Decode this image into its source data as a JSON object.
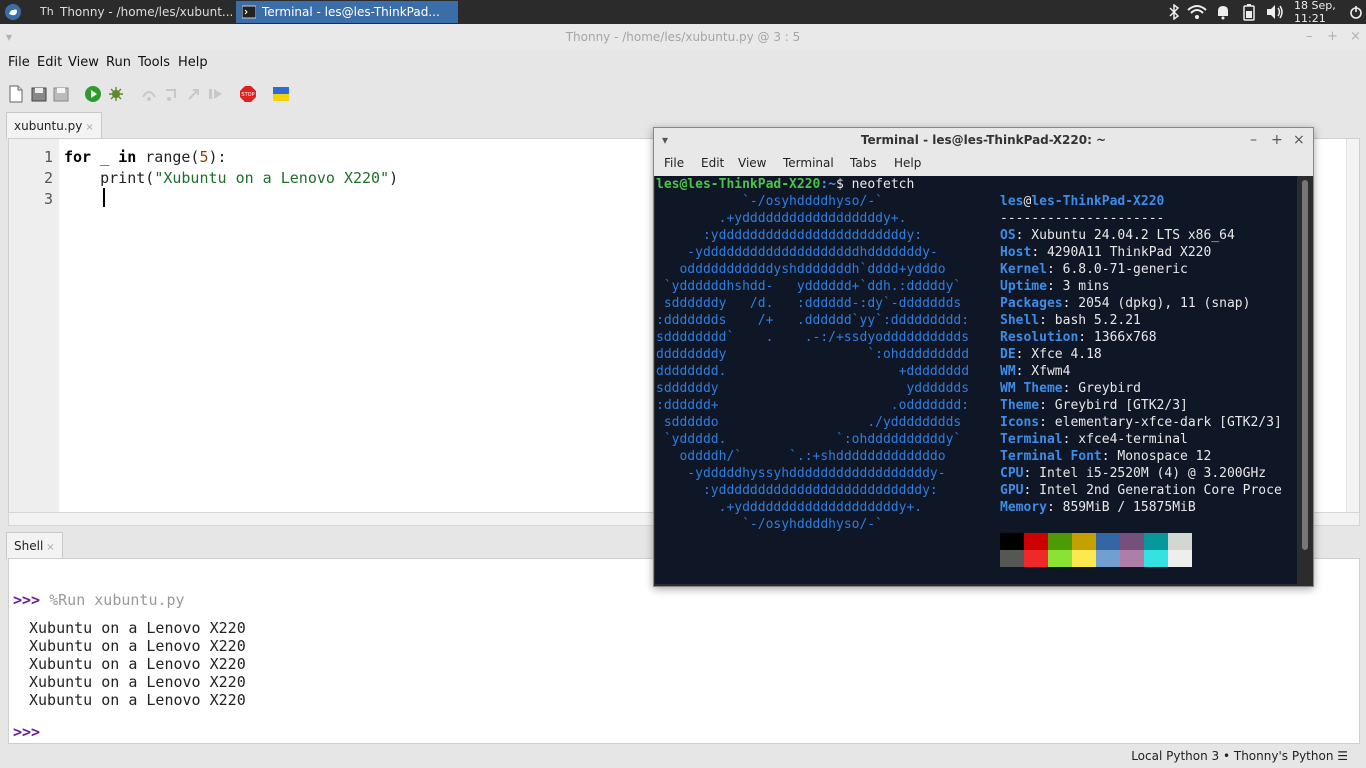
{
  "panel": {
    "tasks": [
      {
        "label": "Thonny  -  /home/les/xubunt..."
      },
      {
        "label": "Terminal - les@les-ThinkPad..."
      }
    ],
    "clock": "18 Sep, 11:21"
  },
  "thonny": {
    "title": "Thonny  -  /home/les/xubuntu.py  @  3 : 5",
    "menu": [
      "File",
      "Edit",
      "View",
      "Run",
      "Tools",
      "Help"
    ],
    "editor_tab": "xubuntu.py",
    "code_lines": [
      {
        "n": "1"
      },
      {
        "n": "2"
      },
      {
        "n": "3"
      }
    ],
    "code": {
      "l1_kw1": "for",
      "l1_mid": " _ ",
      "l1_kw2": "in",
      "l1_fn": " range(",
      "l1_num": "5",
      "l1_end": "):",
      "l2_fn": "    print(",
      "l2_str": "\"Xubuntu on a Lenovo X220\"",
      "l2_end": ")"
    },
    "shell_tab": "Shell",
    "shell": {
      "prompt": ">>>",
      "command": " %Run xubuntu.py",
      "output": [
        "Xubuntu on a Lenovo X220",
        "Xubuntu on a Lenovo X220",
        "Xubuntu on a Lenovo X220",
        "Xubuntu on a Lenovo X220",
        "Xubuntu on a Lenovo X220"
      ],
      "final_prompt": ">>>"
    },
    "status": "Local Python 3  •  Thonny's Python  ☰"
  },
  "terminal": {
    "title": "Terminal - les@les-ThinkPad-X220: ~",
    "menu": [
      "File",
      "Edit",
      "View",
      "Terminal",
      "Tabs",
      "Help"
    ],
    "prompt_user": "les@les-ThinkPad-X220",
    "prompt_path": ":~",
    "prompt_cmd": "$ neofetch",
    "logo": [
      "           `-/osyhddddhyso/-`",
      "        .+yddddddddddddddddddy+.",
      "      :yddddddddddddddddddddddddy:",
      "    -yddddddddddddddddddddhdddddddy-",
      "   odddddddddddyshdddddddh`dddd+ydddo",
      " `yddddddhshdd-   ydddddd+`ddh.:dddddy`",
      " sddddddy   /d.   :dddddd-:dy`-ddddddds",
      ":ddddddds    /+   .dddddd`yy`:ddddddddd:",
      "sdddddddd`    .    .-:/+ssdyodddddddddds",
      "ddddddddy                  `:ohddddddddd",
      "dddddddd.                      +dddddddd",
      "sddddddy                        ydddddds",
      ":dddddd+                      .oddddddd:",
      " sdddddo                   ./ydddddddds",
      " `yddddd.              `:ohddddddddddy`",
      "   oddddh/`      `.:+shdddddddddddddo",
      "    -ydddddhyssyhddddddddddddddddddy-",
      "      :yddddddddddddddddddddddddddy:",
      "        .+yddddddddddddddddddddy+.",
      "           `-/osyhddddhyso/-`"
    ],
    "info_user": "les",
    "info_at": "@",
    "info_host": "les-ThinkPad-X220",
    "info_sep": "---------------------",
    "info": [
      {
        "k": "OS",
        "v": ": Xubuntu 24.04.2 LTS x86_64"
      },
      {
        "k": "Host",
        "v": ": 4290A11 ThinkPad X220"
      },
      {
        "k": "Kernel",
        "v": ": 6.8.0-71-generic"
      },
      {
        "k": "Uptime",
        "v": ": 3 mins"
      },
      {
        "k": "Packages",
        "v": ": 2054 (dpkg), 11 (snap)"
      },
      {
        "k": "Shell",
        "v": ": bash 5.2.21"
      },
      {
        "k": "Resolution",
        "v": ": 1366x768"
      },
      {
        "k": "DE",
        "v": ": Xfce 4.18"
      },
      {
        "k": "WM",
        "v": ": Xfwm4"
      },
      {
        "k": "WM Theme",
        "v": ": Greybird"
      },
      {
        "k": "Theme",
        "v": ": Greybird [GTK2/3]"
      },
      {
        "k": "Icons",
        "v": ": elementary-xfce-dark [GTK2/3]"
      },
      {
        "k": "Terminal",
        "v": ": xfce4-terminal"
      },
      {
        "k": "Terminal Font",
        "v": ": Monospace 12"
      },
      {
        "k": "CPU",
        "v": ": Intel i5-2520M (4) @ 3.200GHz"
      },
      {
        "k": "GPU",
        "v": ": Intel 2nd Generation Core Proce"
      },
      {
        "k": "Memory",
        "v": ": 859MiB / 15875MiB"
      }
    ],
    "palette_top": [
      "#000000",
      "#cc0000",
      "#4e9a06",
      "#c4a000",
      "#3465a4",
      "#75507b",
      "#06989a",
      "#d3d7cf"
    ],
    "palette_bottom": [
      "#555753",
      "#ef2929",
      "#8ae234",
      "#fce94f",
      "#729fcf",
      "#ad7fa8",
      "#34e2e2",
      "#eeeeec"
    ]
  }
}
